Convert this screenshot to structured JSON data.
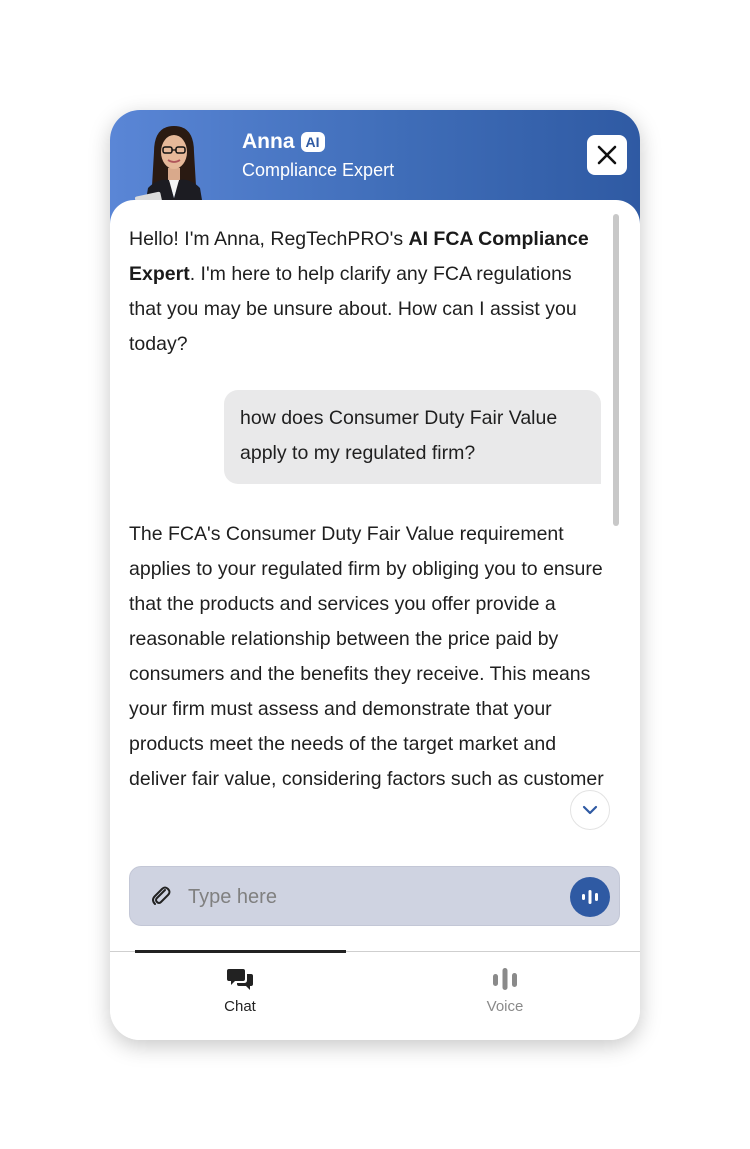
{
  "header": {
    "name": "Anna",
    "badge": "AI",
    "role": "Compliance Expert"
  },
  "messages": {
    "greeting": {
      "part1": "Hello! I'm Anna, RegTechPRO's ",
      "bold": "AI FCA Compliance Expert",
      "part2": ". I'm here to help clarify any FCA regulations that you may be unsure about. How can I assist you today?"
    },
    "user_question": "how does Consumer Duty Fair Value apply to my regulated firm?",
    "answer": "The FCA's Consumer Duty Fair Value requirement applies to your regulated firm by obliging you to ensure that the products and services you offer provide a reasonable relationship between the price paid by consumers and the benefits they receive. This means your firm must assess and demonstrate that your products meet the needs of the target market and deliver fair value, considering factors such as customer"
  },
  "composer": {
    "placeholder": "Type here"
  },
  "tabs": [
    {
      "label": "Chat",
      "active": true,
      "icon": "chat-bubbles-icon"
    },
    {
      "label": "Voice",
      "active": false,
      "icon": "voice-bars-icon"
    }
  ],
  "colors": {
    "brand": "#2f5aa3",
    "header_start": "#5a86d6",
    "composer_bg": "#cfd3e1",
    "user_bubble": "#e9e9ea"
  }
}
